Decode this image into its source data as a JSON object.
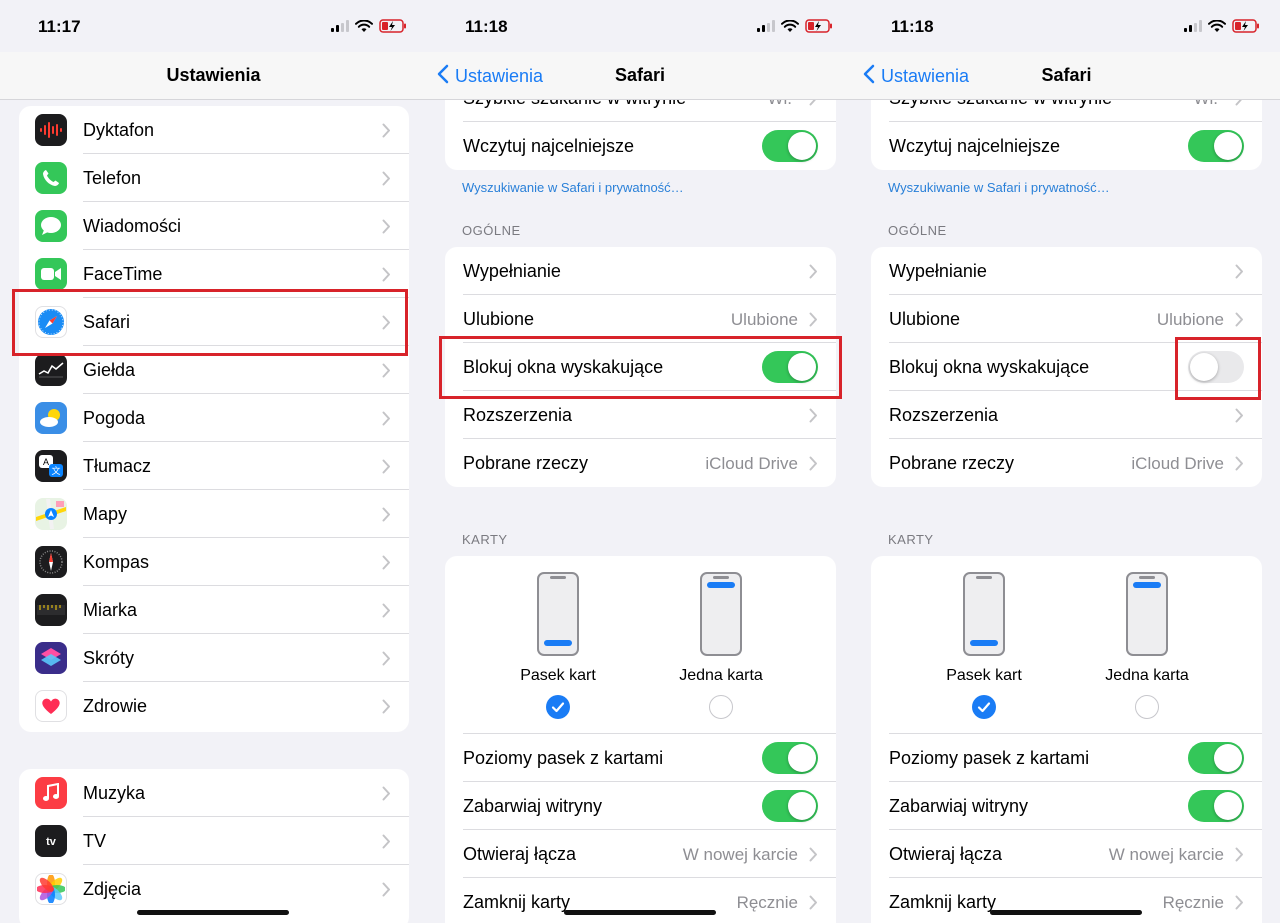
{
  "accent_color": "#1a7cf5",
  "toggle_on_color": "#34c759",
  "highlight_color": "#d8232a",
  "panel1": {
    "time": "11:17",
    "title": "Ustawienia",
    "items": [
      {
        "label": "Dyktafon",
        "icon": "voice-memos-icon"
      },
      {
        "label": "Telefon",
        "icon": "phone-icon"
      },
      {
        "label": "Wiadomości",
        "icon": "messages-icon"
      },
      {
        "label": "FaceTime",
        "icon": "facetime-icon"
      },
      {
        "label": "Safari",
        "icon": "safari-icon"
      },
      {
        "label": "Giełda",
        "icon": "stocks-icon"
      },
      {
        "label": "Pogoda",
        "icon": "weather-icon"
      },
      {
        "label": "Tłumacz",
        "icon": "translate-icon"
      },
      {
        "label": "Mapy",
        "icon": "maps-icon"
      },
      {
        "label": "Kompas",
        "icon": "compass-icon"
      },
      {
        "label": "Miarka",
        "icon": "measure-icon"
      },
      {
        "label": "Skróty",
        "icon": "shortcuts-icon"
      },
      {
        "label": "Zdrowie",
        "icon": "health-icon"
      }
    ],
    "items2": [
      {
        "label": "Muzyka",
        "icon": "music-icon"
      },
      {
        "label": "TV",
        "icon": "tv-icon"
      },
      {
        "label": "Zdjęcia",
        "icon": "photos-icon"
      }
    ]
  },
  "panel2": {
    "time": "11:18",
    "back": "Ustawienia",
    "title": "Safari",
    "partial_row": {
      "label": "Szybkie szukanie w witrynie",
      "value": "Wł."
    },
    "top_row": {
      "label": "Wczytuj najcelniejsze",
      "on": true
    },
    "privacy_link": "Wyszukiwanie w Safari i prywatność…",
    "general_header": "OGÓLNE",
    "general": [
      {
        "label": "Wypełnianie",
        "value": ""
      },
      {
        "label": "Ulubione",
        "value": "Ulubione"
      },
      {
        "label": "Blokuj okna wyskakujące",
        "toggle": true
      },
      {
        "label": "Rozszerzenia",
        "value": ""
      },
      {
        "label": "Pobrane rzeczy",
        "value": "iCloud Drive"
      }
    ],
    "tabs_header": "KARTY",
    "tab_option_1": "Pasek kart",
    "tab_option_2": "Jedna karta",
    "tabs_rows": [
      {
        "label": "Poziomy pasek z kartami",
        "on": true
      },
      {
        "label": "Zabarwiaj witryny",
        "on": true
      },
      {
        "label": "Otwieraj łącza",
        "value": "W nowej karcie"
      },
      {
        "label": "Zamknij karty",
        "value": "Ręcznie"
      }
    ]
  },
  "panel3": {
    "time": "11:18",
    "back": "Ustawienia",
    "title": "Safari",
    "partial_row": {
      "label": "Szybkie szukanie w witrynie",
      "value": "Wł."
    },
    "top_row": {
      "label": "Wczytuj najcelniejsze",
      "on": true
    },
    "privacy_link": "Wyszukiwanie w Safari i prywatność…",
    "general_header": "OGÓLNE",
    "general": [
      {
        "label": "Wypełnianie",
        "value": ""
      },
      {
        "label": "Ulubione",
        "value": "Ulubione"
      },
      {
        "label": "Blokuj okna wyskakujące",
        "toggle": false
      },
      {
        "label": "Rozszerzenia",
        "value": ""
      },
      {
        "label": "Pobrane rzeczy",
        "value": "iCloud Drive"
      }
    ],
    "tabs_header": "KARTY",
    "tab_option_1": "Pasek kart",
    "tab_option_2": "Jedna karta",
    "tabs_rows": [
      {
        "label": "Poziomy pasek z kartami",
        "on": true
      },
      {
        "label": "Zabarwiaj witryny",
        "on": true
      },
      {
        "label": "Otwieraj łącza",
        "value": "W nowej karcie"
      },
      {
        "label": "Zamknij karty",
        "value": "Ręcznie"
      }
    ]
  }
}
